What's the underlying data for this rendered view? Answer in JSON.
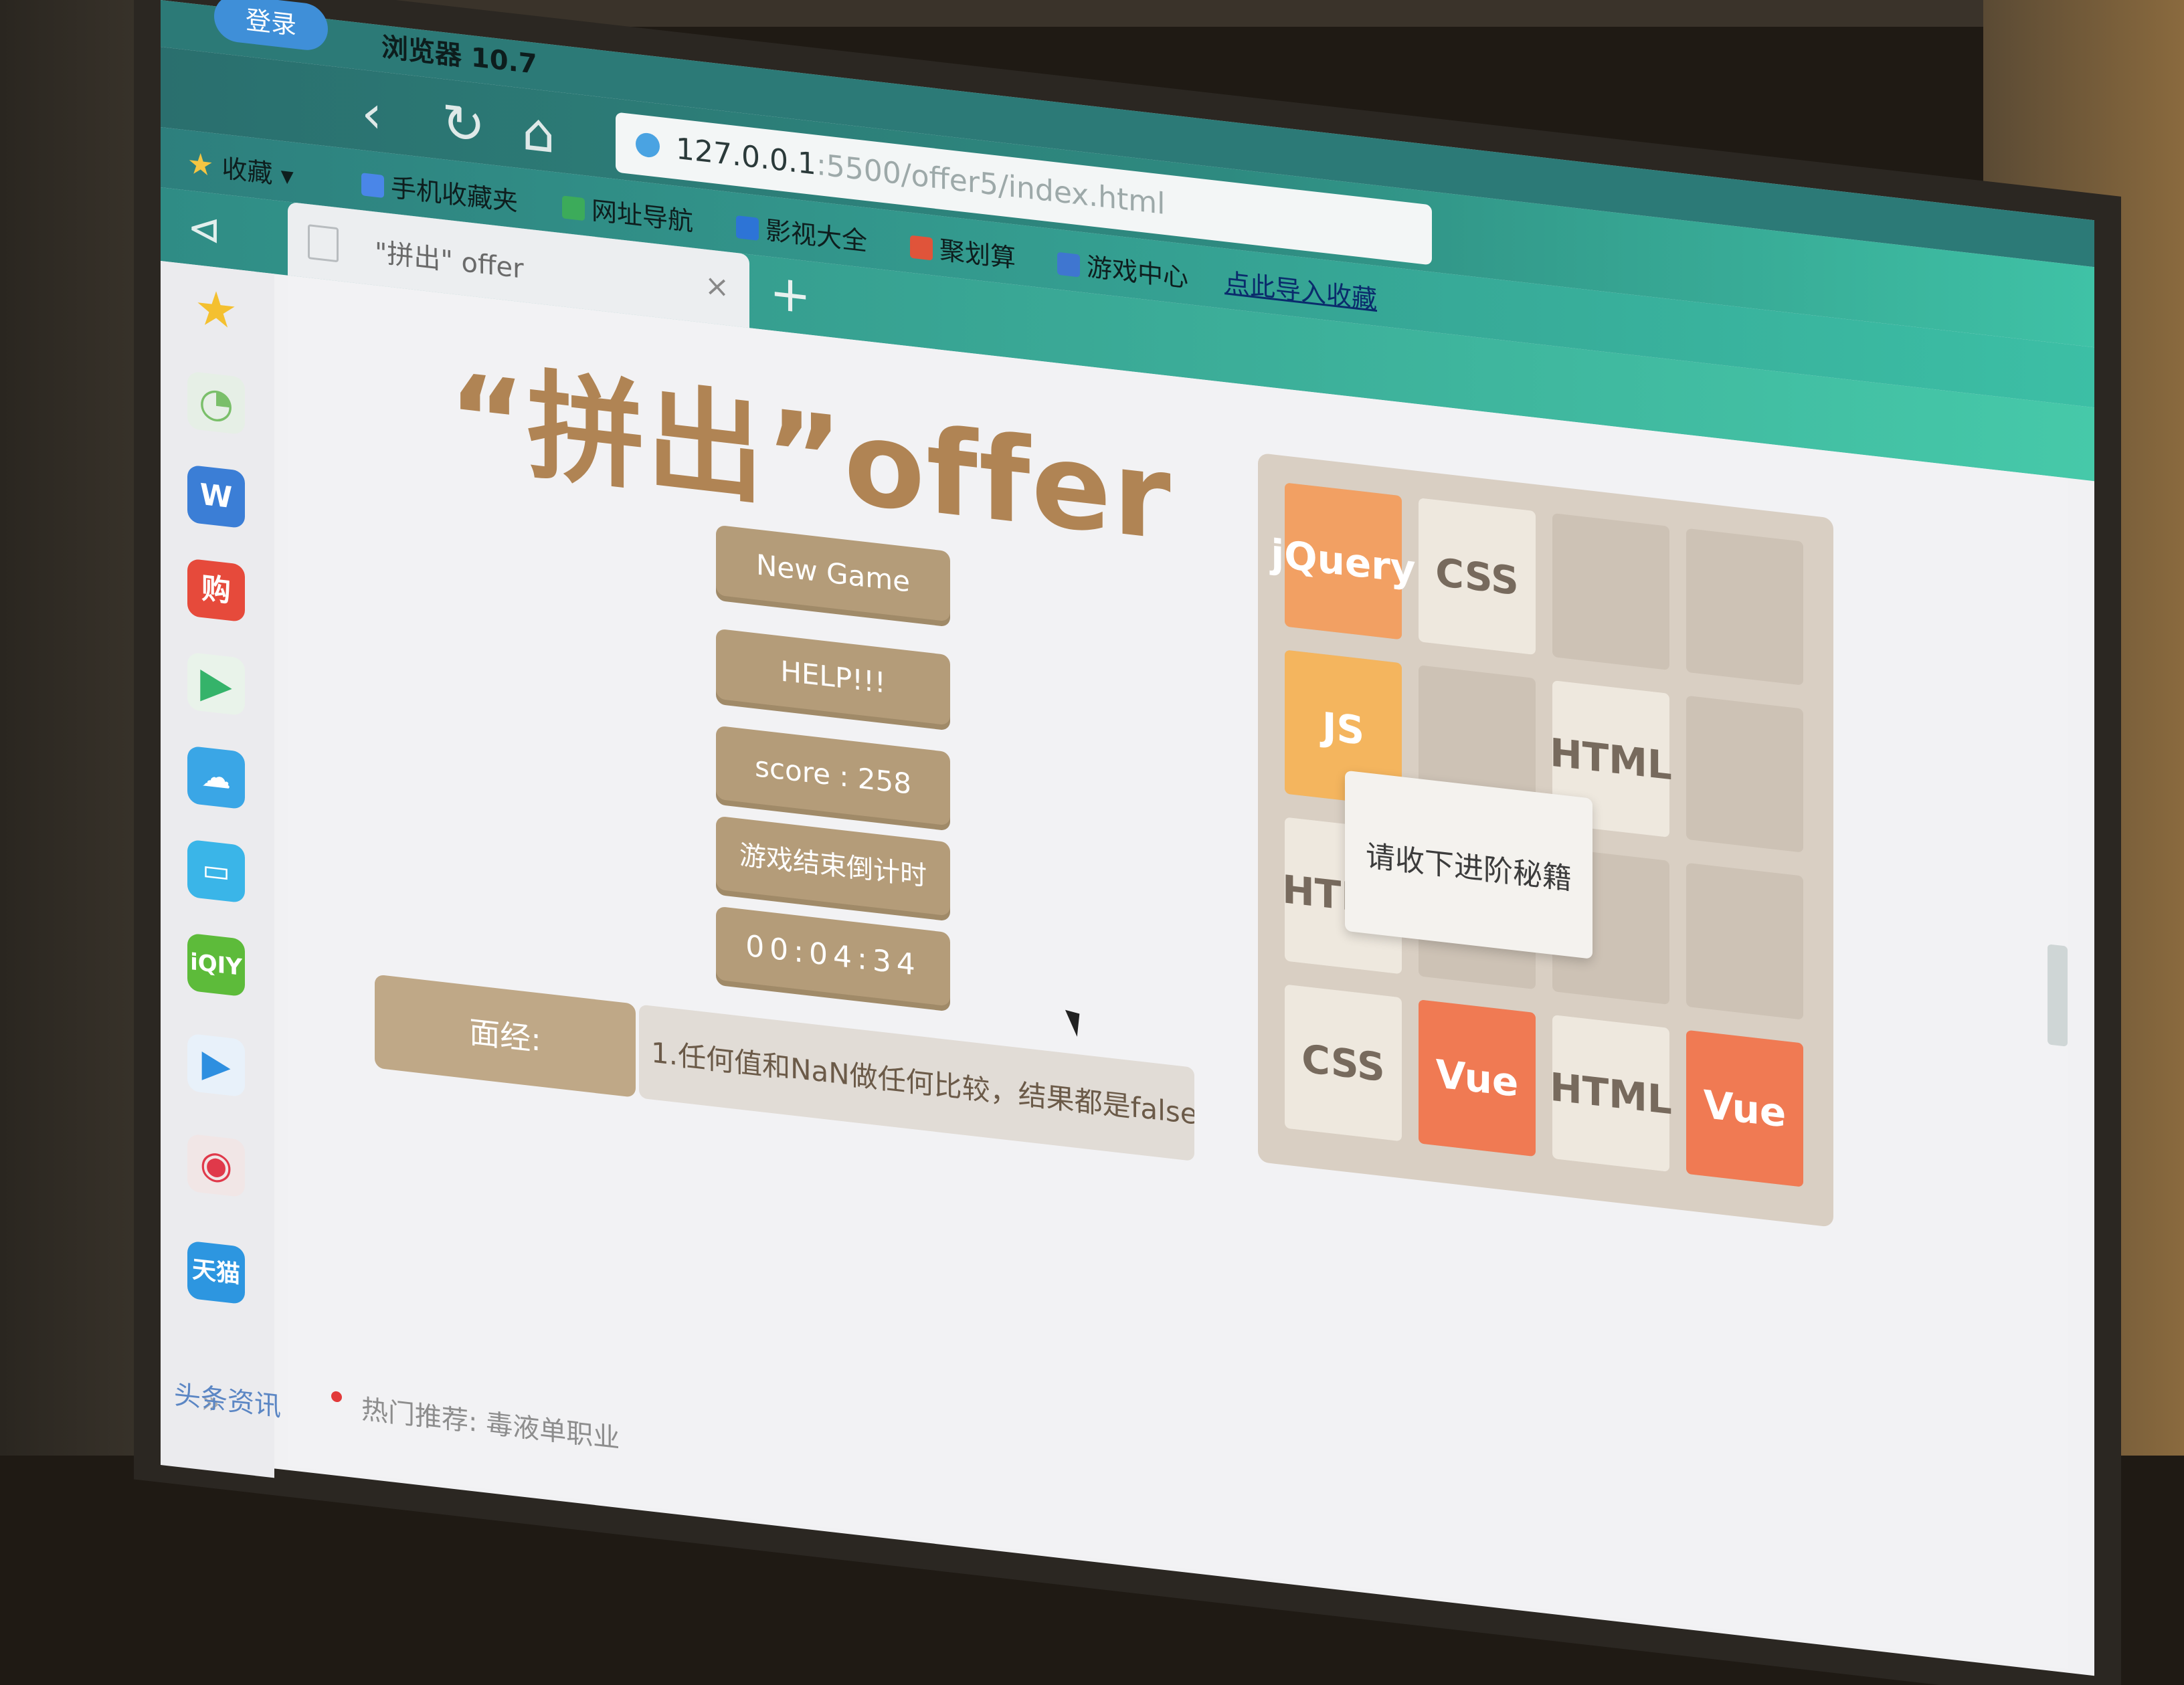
{
  "browser": {
    "login_label": "登录",
    "name_fragment": "浏览器 10.7",
    "url_host": "127.0.0.1",
    "url_path": ":5500/offer5/index.html",
    "favorites_label": "收藏",
    "bookmarks": [
      {
        "label": "手机收藏夹",
        "color": "#4a86e8"
      },
      {
        "label": "网址导航",
        "color": "#3cab5a"
      },
      {
        "label": "影视大全",
        "color": "#2d74d6"
      },
      {
        "label": "聚划算",
        "color": "#e0543a"
      },
      {
        "label": "游戏中心",
        "color": "#3f76d0"
      }
    ],
    "import_link": "点此导入收藏",
    "tab_title": "\"拼出\" offer"
  },
  "sidebar": {
    "icons": [
      "star-icon",
      "clock-icon",
      "word-icon",
      "shop-icon",
      "video-play-icon",
      "cloud-icon",
      "tv-icon",
      "iqiyi-icon",
      "player-icon",
      "record-icon",
      "tianmao-icon"
    ]
  },
  "page": {
    "title": "“拼出”offer",
    "buttons": {
      "new_game": "New Game",
      "help": "HELP!!!",
      "score": "score : 258",
      "countdown_label": "游戏结束倒计时",
      "timer": "00:04:34"
    },
    "interview": {
      "label": "面经:",
      "text": "1.任何值和NaN做任何比较，结果都是false;"
    },
    "popup": "请收下进阶秘籍"
  },
  "board": {
    "rows": [
      [
        {
          "label": "jQuery",
          "style": "orange"
        },
        {
          "label": "CSS",
          "style": "light"
        },
        null,
        null
      ],
      [
        {
          "label": "JS",
          "style": "amber"
        },
        null,
        {
          "label": "HTML",
          "style": "light"
        },
        null
      ],
      [
        {
          "label": "HTML",
          "style": "light"
        },
        null,
        null,
        null
      ],
      [
        {
          "label": "CSS",
          "style": "light"
        },
        {
          "label": "Vue",
          "style": "red"
        },
        {
          "label": "HTML",
          "style": "light"
        },
        {
          "label": "Vue",
          "style": "red"
        }
      ]
    ]
  },
  "footer": {
    "news": "头条资讯",
    "hot": "热门推荐: 毒液单职业"
  },
  "colors": {
    "accent": "#b49c79",
    "title": "#b08454",
    "toolbar": "#2e8a80"
  }
}
